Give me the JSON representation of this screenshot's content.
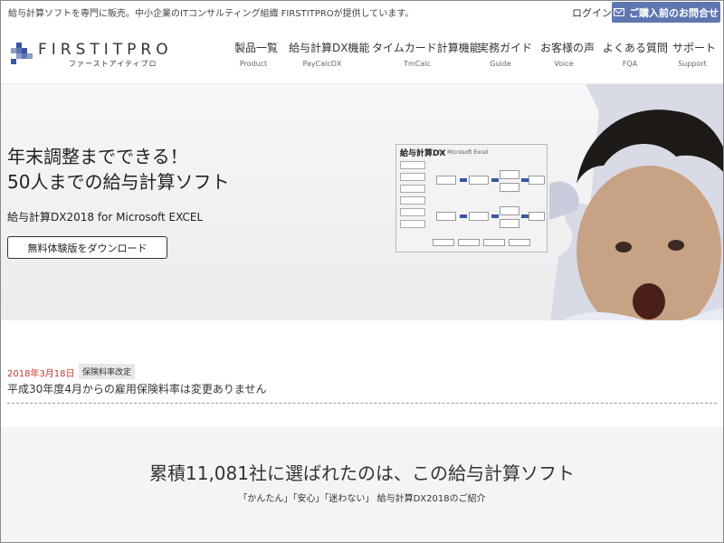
{
  "topbar": {
    "tagline": "給与計算ソフトを専門に販売。中小企業のITコンサルティング組織 FIRSTITPROが提供しています。",
    "login": "ログイン",
    "contact": "ご購入前のお問合せ"
  },
  "logo": {
    "name": "FIRSTITPRO",
    "sub": "ファーストアイティプロ"
  },
  "nav": [
    {
      "jp": "製品一覧",
      "en": "Product"
    },
    {
      "jp": "給与計算DX機能",
      "en": "PayCalcDX"
    },
    {
      "jp": "タイムカード計算機能",
      "en": "TmCalc"
    },
    {
      "jp": "実務ガイド",
      "en": "Guide"
    },
    {
      "jp": "お客様の声",
      "en": "Voice"
    },
    {
      "jp": "よくある質問",
      "en": "FQA"
    },
    {
      "jp": "サポート",
      "en": "Support"
    }
  ],
  "hero": {
    "title_line1": "年末調整までできる！",
    "title_line2": "50人までの給与計算ソフト",
    "product": "給与計算DX2018 for Microsoft EXCEL",
    "button": "無料体験版をダウンロード",
    "screenshot_title": "給与計算DX",
    "screenshot_sub": "for Microsoft Excel"
  },
  "news": {
    "date": "2018年3月18日",
    "tag": "保険料率改定",
    "text": "平成30年度4月からの雇用保険料率は変更ありません"
  },
  "intro": {
    "title": "累積11,081社に選ばれたのは、この給与計算ソフト",
    "sub": "「かんたん」「安心」「迷わない」 給与計算DX2018のご紹介"
  },
  "colors": {
    "accent": "#5f77b0",
    "date": "#c0392b"
  }
}
